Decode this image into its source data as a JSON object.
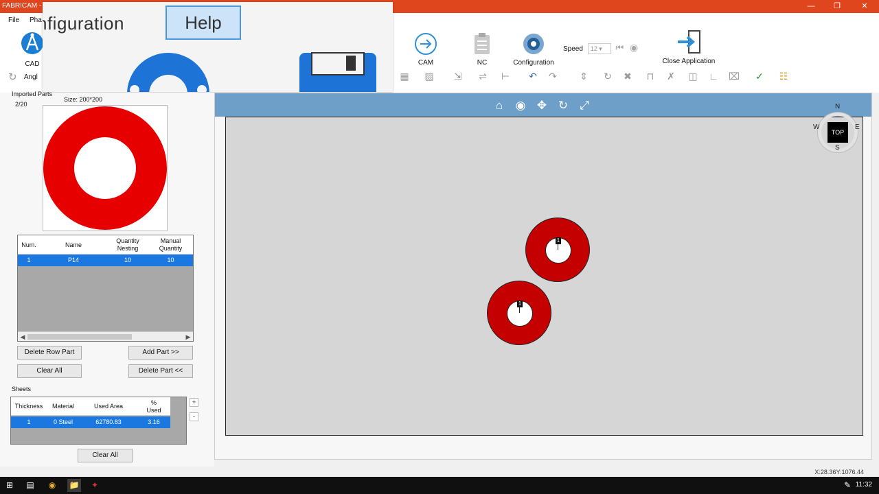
{
  "window": {
    "title": "FABRICAM - F"
  },
  "menu": {
    "file": "File",
    "phase": "Pha"
  },
  "ribbon": {
    "cad": "CAD",
    "angle": "Angl",
    "cam": "CAM",
    "nc": "NC",
    "configuration": "Configuration",
    "speed_label": "Speed",
    "speed_value": "12",
    "close_application": "Close Application"
  },
  "overlay_menu": {
    "configuration": "nfiguration",
    "help": "Help"
  },
  "parts_panel": {
    "title": "Imported Parts",
    "counter": "2/20",
    "size": "Size: 200*200",
    "columns": [
      "Num.",
      "Name",
      "Quantity\nNesting",
      "Manual\nQuantity"
    ],
    "rows": [
      {
        "num": "1",
        "name": "P14",
        "qty_nesting": "10",
        "manual_qty": "10"
      }
    ],
    "delete_row": "Delete Row Part",
    "add_part": "Add Part >>",
    "clear_all": "Clear All",
    "delete_part": "Delete Part <<"
  },
  "sheets_panel": {
    "title": "Sheets",
    "columns": [
      "Thickness",
      "Material",
      "Used Area",
      "%\nUsed"
    ],
    "rows": [
      {
        "thickness": "1",
        "material": "0  Steel",
        "used_area": "62780.83",
        "pct_used": "3.16"
      }
    ],
    "plus": "+",
    "minus": "-",
    "clear_all": "Clear All"
  },
  "viewport": {
    "compass": {
      "n": "N",
      "s": "S",
      "e": "E",
      "w": "W",
      "top": "TOP"
    },
    "part_label": "1"
  },
  "status": {
    "coords": "X:28.36Y:1076.44"
  },
  "taskbar": {
    "time": "11:32"
  },
  "colors": {
    "titlebar": "#e0461d",
    "selection": "#1a78e0",
    "part": "#c40000",
    "viewtop": "#6d9fc9"
  }
}
